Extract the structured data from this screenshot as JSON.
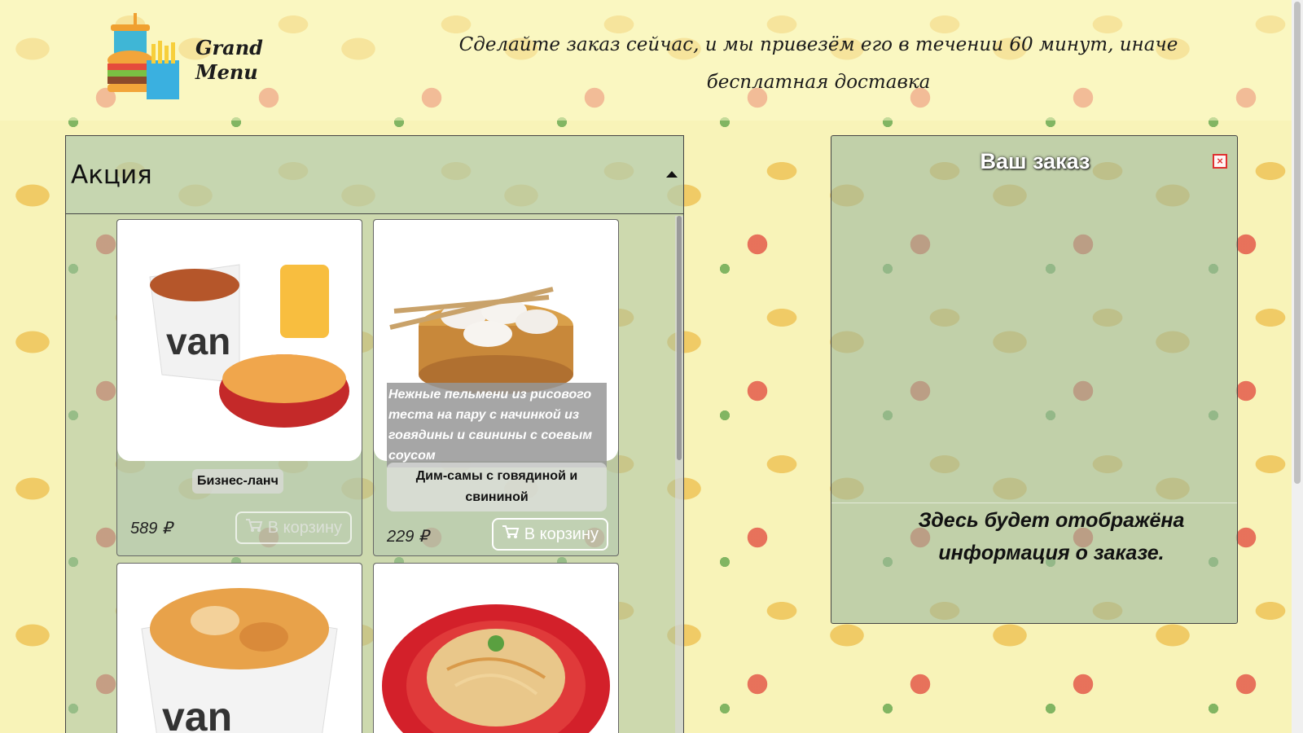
{
  "header": {
    "logo_line1": "Grand",
    "logo_line2": "Menu",
    "tagline": "Сделайте заказ сейчас, и мы привезём его в течении 60 минут, иначе бесплатная доставка"
  },
  "menu": {
    "section_title": "Акция",
    "currency": "₽",
    "cart_label": "В корзину",
    "products": [
      {
        "name": "Бизнес-ланч",
        "price": "589 ₽",
        "description": ""
      },
      {
        "name": "Дим-самы с говядиной и свининой",
        "price": "229 ₽",
        "description": "Нежные пельмени из рисового теста на пару с начинкой из говядины и свинины с соевым соусом"
      },
      {
        "name": "",
        "price": "",
        "description": ""
      },
      {
        "name": "",
        "price": "",
        "description": ""
      }
    ]
  },
  "order": {
    "title": "Ваш заказ",
    "close_label": "×",
    "info": "Здесь будет отображёна информация о заказе."
  },
  "icons": [
    "burger-logo-icon",
    "chevron-up-icon",
    "cart-icon",
    "close-icon"
  ],
  "colors": {
    "background": "#f8f3b8",
    "panel": "#aac3a5",
    "close_accent": "#e03030"
  }
}
